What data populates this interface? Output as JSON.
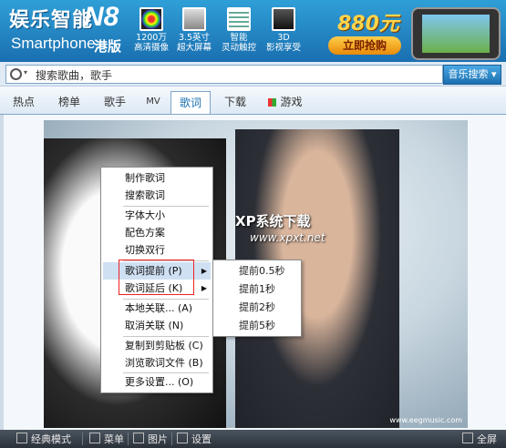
{
  "banner": {
    "brand_cn": "娱乐智能",
    "brand_model": "N8",
    "brand_en": "Smartphone",
    "edition": "港版",
    "features": [
      {
        "top": "1200万",
        "bottom": "高清摄像",
        "icon": "camera-lens-icon"
      },
      {
        "top": "3.5英寸",
        "bottom": "超大屏幕",
        "icon": "screen-icon"
      },
      {
        "top": "智能",
        "bottom": "灵动触控",
        "icon": "touch-icon"
      },
      {
        "top": "3D",
        "bottom": "影视享受",
        "icon": "3d-icon"
      }
    ],
    "price": "880元",
    "buy_label": "立即抢购",
    "phone_image": "phone-icon"
  },
  "search": {
    "value": "搜索歌曲，歌手",
    "button_label": "音乐搜索 ▾"
  },
  "tabs": [
    {
      "label": "热点",
      "active": false
    },
    {
      "label": "榜单",
      "active": false
    },
    {
      "label": "歌手",
      "active": false
    },
    {
      "label": "MV",
      "active": false
    },
    {
      "label": "歌词",
      "active": true
    },
    {
      "label": "下载",
      "active": false
    },
    {
      "label": "游戏",
      "active": false
    }
  ],
  "watermark": {
    "line1": "XP系统下载",
    "line2": "www.xpxt.net"
  },
  "photo_credit": "www.eegmusic.com",
  "context_menu": {
    "items": [
      "制作歌词",
      "搜索歌词",
      "字体大小",
      "配色方案",
      "切换双行",
      "歌词提前 (P)",
      "歌词延后 (K)",
      "本地关联... (A)",
      "取消关联 (N)",
      "复制到剪贴板 (C)",
      "浏览歌词文件 (B)",
      "更多设置... (O)"
    ],
    "highlighted": "歌词提前 (P)"
  },
  "submenu": {
    "items": [
      "提前0.5秒",
      "提前1秒",
      "提前2秒",
      "提前5秒"
    ]
  },
  "footer": {
    "classic_mode": "经典模式",
    "menu": "菜单",
    "pictures": "图片",
    "settings": "设置",
    "fullscreen": "全屏"
  },
  "colors": {
    "banner_blue": "#1a6fb0",
    "menu_highlight": "#cfe0f3",
    "red_box": "#e22222",
    "footer_bg": "#2a3138"
  }
}
